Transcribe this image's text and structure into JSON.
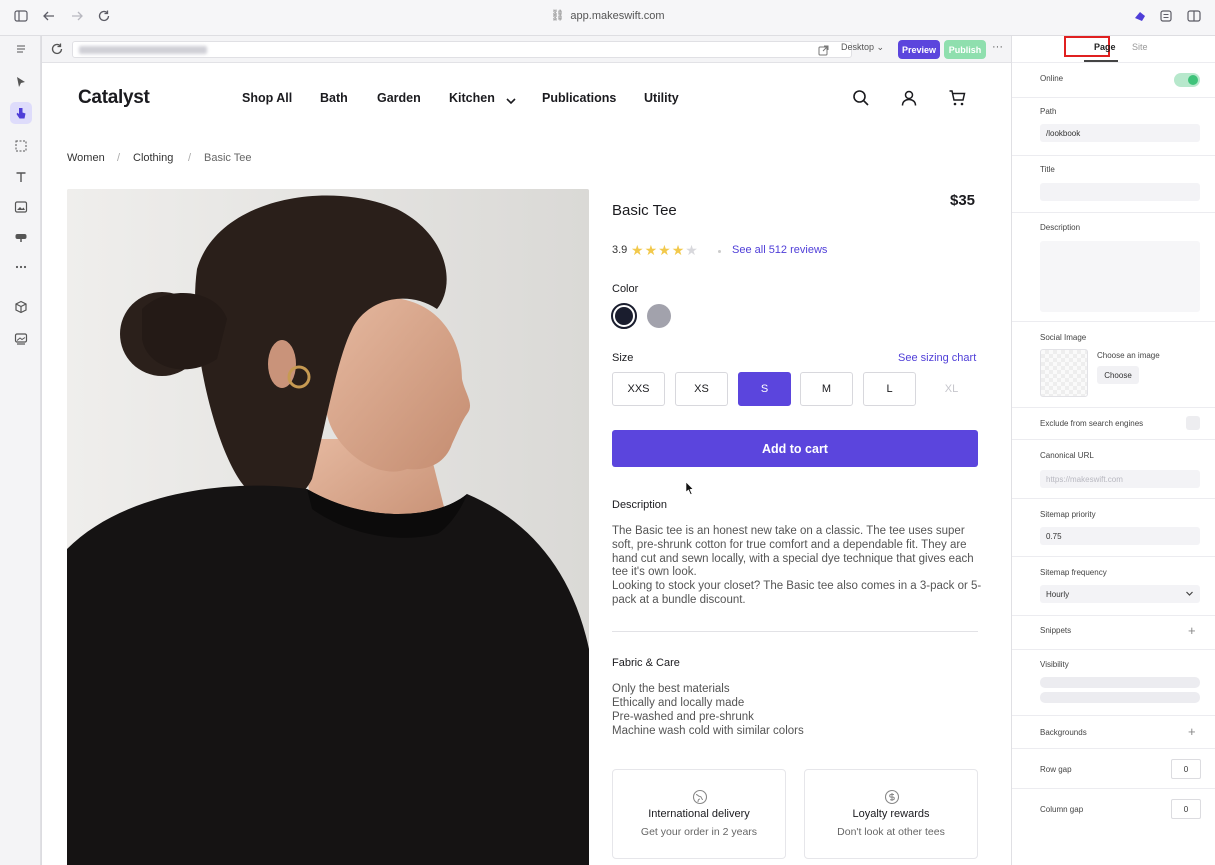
{
  "browser": {
    "url": "app.makeswift.com"
  },
  "canvas_bar": {
    "device": "Desktop",
    "preview_label": "Preview",
    "publish_label": "Publish",
    "more": "···"
  },
  "site": {
    "logo": "Catalyst",
    "nav": [
      "Shop All",
      "Bath",
      "Garden",
      "Kitchen",
      "Publications",
      "Utility"
    ],
    "breadcrumb": [
      "Women",
      "Clothing",
      "Basic Tee"
    ],
    "breadcrumb_sep": "/",
    "product": {
      "title": "Basic Tee",
      "price": "$35",
      "rating": "3.9",
      "rating_stars": 4,
      "reviews_link": "See all 512 reviews",
      "color_label": "Color",
      "colors": [
        "#1a1d2e",
        "#a2a2ac"
      ],
      "size_label": "Size",
      "sizing_chart": "See sizing chart",
      "sizes": [
        "XXS",
        "XS",
        "S",
        "M",
        "L",
        "XL"
      ],
      "selected_size": "S",
      "add_to_cart": "Add to cart",
      "description_title": "Description",
      "description_1": "The Basic tee is an honest new take on a classic. The tee uses super soft, pre-shrunk cotton for true comfort and a dependable fit. They are hand cut and sewn locally, with a special dye technique that gives each tee it's own look.",
      "description_2": "Looking to stock your closet? The Basic tee also comes in a 3-pack or 5-pack at a bundle discount.",
      "fabric_title": "Fabric & Care",
      "fabric_items": [
        "Only the best materials",
        "Ethically and locally made",
        "Pre-washed and pre-shrunk",
        "Machine wash cold with similar colors"
      ],
      "features": [
        {
          "title": "International delivery",
          "subtitle": "Get your order in 2 years"
        },
        {
          "title": "Loyalty rewards",
          "subtitle": "Don't look at other tees"
        }
      ]
    }
  },
  "panel": {
    "tabs": [
      "Page",
      "Site"
    ],
    "active_tab": "Page",
    "online_label": "Online",
    "online": true,
    "path_label": "Path",
    "path_value": "/lookbook",
    "title_label": "Title",
    "description_label": "Description",
    "social_image_label": "Social Image",
    "choose_image_label": "Choose an image",
    "choose_button": "Choose",
    "exclude_label": "Exclude from search engines",
    "canonical_label": "Canonical URL",
    "canonical_placeholder": "https://makeswift.com",
    "sitemap_priority_label": "Sitemap priority",
    "sitemap_priority_value": "0.75",
    "sitemap_frequency_label": "Sitemap frequency",
    "sitemap_frequency_value": "Hourly",
    "snippets_label": "Snippets",
    "visibility_label": "Visibility",
    "backgrounds_label": "Backgrounds",
    "row_gap_label": "Row gap",
    "row_gap_value": "0",
    "column_gap_label": "Column gap",
    "column_gap_value": "0"
  },
  "colors": {
    "accent": "#5b45dd",
    "highlight": "#e02020",
    "toggle_on": "#3fc37a"
  }
}
